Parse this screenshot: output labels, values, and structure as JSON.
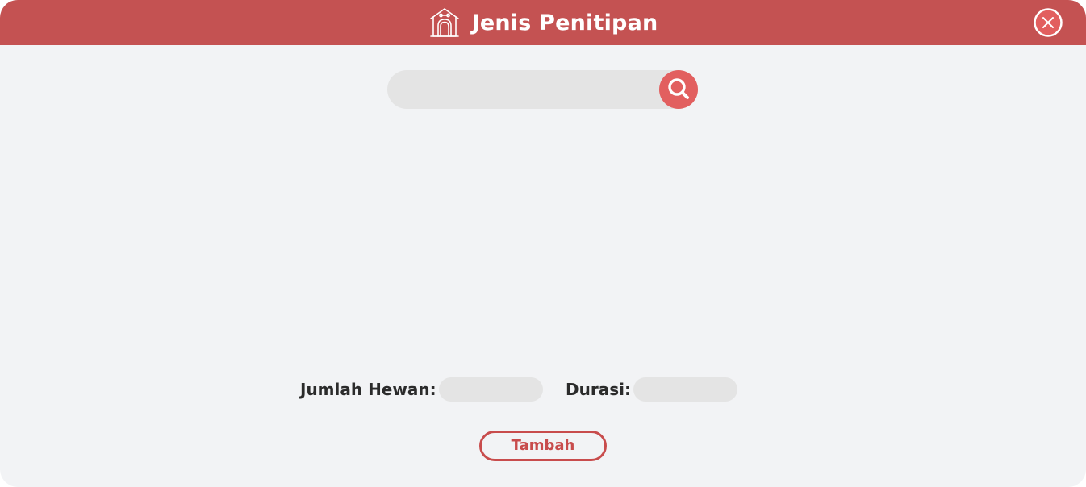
{
  "header": {
    "title": "Jenis Penitipan",
    "icon": "dog-house-icon",
    "close_icon": "close-circle-icon",
    "background_color": "#c45252"
  },
  "search": {
    "value": "",
    "placeholder": "",
    "button_icon": "search-icon",
    "button_color": "#e25f5f"
  },
  "form": {
    "jumlah_hewan_label": "Jumlah Hewan:",
    "jumlah_hewan_value": "",
    "durasi_label": "Durasi:",
    "durasi_value": ""
  },
  "actions": {
    "tambah_label": "Tambah",
    "accent_color": "#c84c4c"
  }
}
